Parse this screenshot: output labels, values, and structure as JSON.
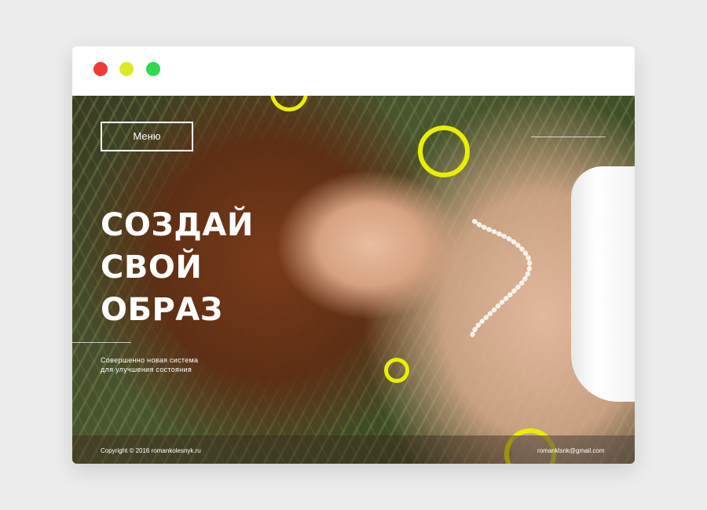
{
  "window": {
    "controls": [
      {
        "name": "close",
        "color": "#f03a37"
      },
      {
        "name": "minimize",
        "color": "#dbe925"
      },
      {
        "name": "maximize",
        "color": "#2fd94b"
      }
    ]
  },
  "hero": {
    "menu_label": "Меню",
    "headline": [
      "СОЗДАЙ",
      "СВОЙ",
      "ОБРАЗ"
    ],
    "subtitle": [
      "Совершенно новая система",
      "для улучшения состояния"
    ],
    "side_text": "romankolesnyk.ru",
    "accent_color": "#e8ef00"
  },
  "footer": {
    "copyright": "Copyright © 2016  romankolesnyk.ru",
    "email": "romanklsnk@gmail.com"
  }
}
